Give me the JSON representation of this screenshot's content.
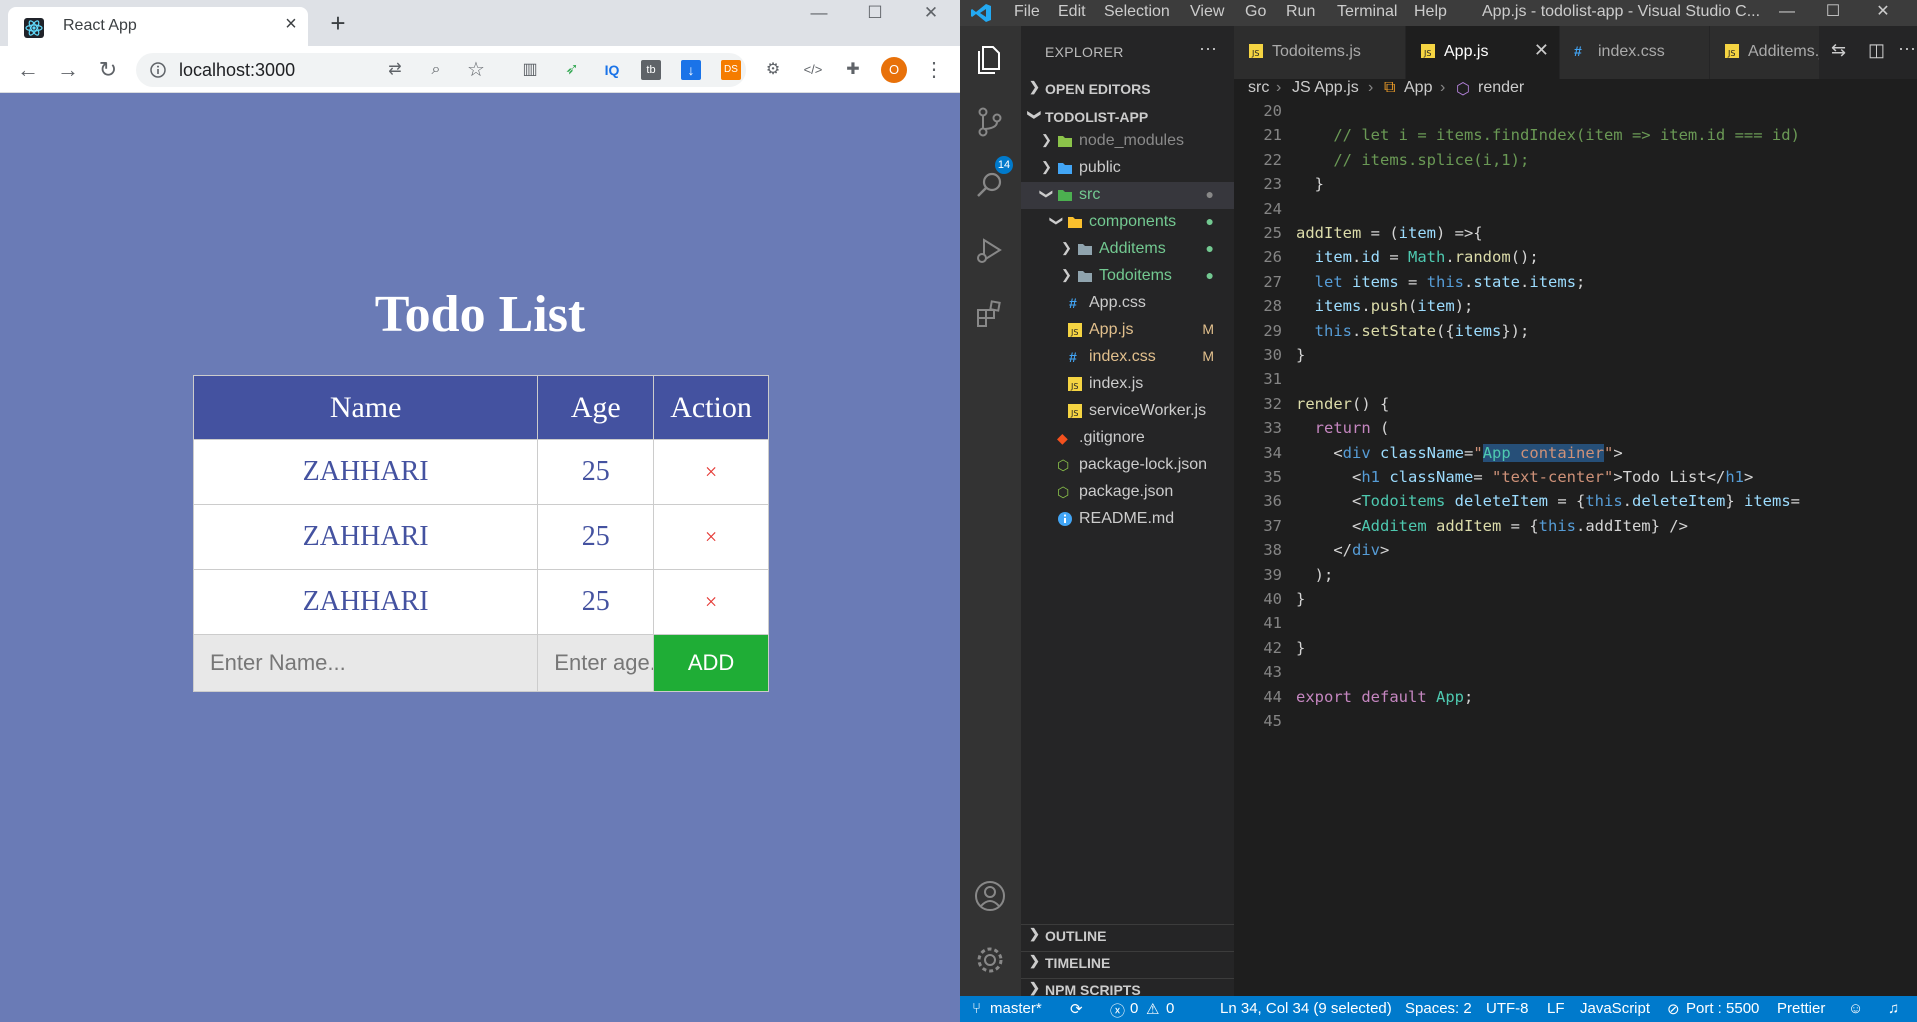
{
  "browser": {
    "tab_title": "React App",
    "url": "localhost:3000",
    "profile_initial": "O",
    "page": {
      "title": "Todo List",
      "headers": [
        "Name",
        "Age",
        "Action"
      ],
      "rows": [
        {
          "name": "ZAHHARI",
          "age": "25",
          "action": "×"
        },
        {
          "name": "ZAHHARI",
          "age": "25",
          "action": "×"
        },
        {
          "name": "ZAHHARI",
          "age": "25",
          "action": "×"
        }
      ],
      "name_placeholder": "Enter Name...",
      "age_placeholder": "Enter age...",
      "add_label": "ADD"
    },
    "extensions": [
      "IQ",
      "tb",
      "DS"
    ]
  },
  "vscode": {
    "menu": [
      "File",
      "Edit",
      "Selection",
      "View",
      "Go",
      "Run",
      "Terminal",
      "Help"
    ],
    "window_title": "App.js - todolist-app - Visual Studio C...",
    "scm_badge": "14",
    "explorer": {
      "title": "EXPLORER",
      "more": "···",
      "open_editors": "OPEN EDITORS",
      "project": "TODOLIST-APP",
      "items": [
        {
          "name": "node_modules",
          "decoration": ""
        },
        {
          "name": "public",
          "decoration": ""
        },
        {
          "name": "src",
          "decoration": "●"
        },
        {
          "name": "components",
          "decoration": "●"
        },
        {
          "name": "Additems",
          "decoration": "●"
        },
        {
          "name": "Todoitems",
          "decoration": "●"
        },
        {
          "name": "App.css",
          "decoration": ""
        },
        {
          "name": "App.js",
          "decoration": "M"
        },
        {
          "name": "index.css",
          "decoration": "M"
        },
        {
          "name": "index.js",
          "decoration": ""
        },
        {
          "name": "serviceWorker.js",
          "decoration": ""
        },
        {
          "name": ".gitignore",
          "decoration": ""
        },
        {
          "name": "package-lock.json",
          "decoration": ""
        },
        {
          "name": "package.json",
          "decoration": ""
        },
        {
          "name": "README.md",
          "decoration": ""
        }
      ],
      "outline": "OUTLINE",
      "timeline": "TIMELINE",
      "npm": "NPM SCRIPTS"
    },
    "tabs": [
      "Todoitems.js",
      "App.js",
      "index.css",
      "Additems.js"
    ],
    "breadcrumb": [
      "src",
      "JS App.js",
      "App",
      "render"
    ],
    "code_lines": [
      {
        "n": "20",
        "text": ""
      },
      {
        "n": "21",
        "text": "    // let i = items.findIndex(item => item.id === id);"
      },
      {
        "n": "22",
        "text": "    // items.splice(i,1);"
      },
      {
        "n": "23",
        "text": "  }"
      },
      {
        "n": "24",
        "text": ""
      },
      {
        "n": "25",
        "text": "addItem = (item) =>{"
      },
      {
        "n": "26",
        "text": "  item.id = Math.random();"
      },
      {
        "n": "27",
        "text": "  let items = this.state.items;"
      },
      {
        "n": "28",
        "text": "  items.push(item);"
      },
      {
        "n": "29",
        "text": "  this.setState({items});"
      },
      {
        "n": "30",
        "text": "}"
      },
      {
        "n": "31",
        "text": ""
      },
      {
        "n": "32",
        "text": "render() {"
      },
      {
        "n": "33",
        "text": "  return ("
      },
      {
        "n": "34",
        "text": "    <div className=\"App container\">"
      },
      {
        "n": "35",
        "text": "      <h1 className= \"text-center\">Todo List</h1>"
      },
      {
        "n": "36",
        "text": "      <Todoitems deleteItem = {this.deleteItem} items={this.state.items} />"
      },
      {
        "n": "37",
        "text": "      <Additem addItem = {this.addItem} />"
      },
      {
        "n": "38",
        "text": "    </div>"
      },
      {
        "n": "39",
        "text": "  );"
      },
      {
        "n": "40",
        "text": "}"
      },
      {
        "n": "41",
        "text": ""
      },
      {
        "n": "42",
        "text": "}"
      },
      {
        "n": "43",
        "text": ""
      },
      {
        "n": "44",
        "text": "export default App;"
      },
      {
        "n": "45",
        "text": ""
      }
    ],
    "status": {
      "branch": "master*",
      "errors": "0",
      "warnings": "0",
      "position": "Ln 34, Col 34 (9 selected)",
      "spaces": "Spaces: 2",
      "encoding": "UTF-8",
      "eol": "LF",
      "language": "JavaScript",
      "port": "Port : 5500",
      "prettier": "Prettier"
    }
  },
  "colors": {
    "page_bg": "#6a7bb6",
    "table_header": "#4452a0",
    "add_button": "#1fad36",
    "delete": "#e53935",
    "status_bar": "#007acc"
  }
}
